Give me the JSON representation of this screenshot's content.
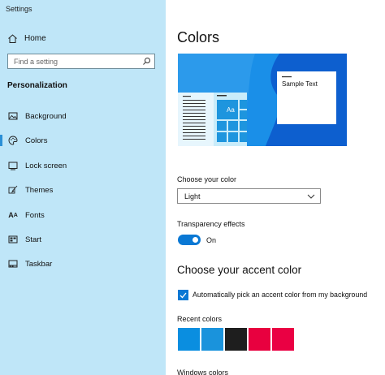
{
  "window": {
    "title": "Settings"
  },
  "sidebar": {
    "home_label": "Home",
    "search_placeholder": "Find a setting",
    "section_heading": "Personalization",
    "items": [
      {
        "label": "Background",
        "icon": "picture-icon"
      },
      {
        "label": "Colors",
        "icon": "palette-icon",
        "selected": true
      },
      {
        "label": "Lock screen",
        "icon": "lock-screen-icon"
      },
      {
        "label": "Themes",
        "icon": "brush-icon"
      },
      {
        "label": "Fonts",
        "icon": "font-icon"
      },
      {
        "label": "Start",
        "icon": "start-icon"
      },
      {
        "label": "Taskbar",
        "icon": "taskbar-icon"
      }
    ]
  },
  "main": {
    "title": "Colors",
    "preview": {
      "sample_text": "Sample Text",
      "tile_label": "Aa"
    },
    "choose_color": {
      "label": "Choose your color",
      "value": "Light"
    },
    "transparency": {
      "label": "Transparency effects",
      "state": "On"
    },
    "accent": {
      "heading": "Choose your accent color",
      "auto_pick_label": "Automatically pick an accent color from my background",
      "auto_pick_checked": true
    },
    "recent_colors": {
      "label": "Recent colors",
      "colors": [
        "#0a8ee0",
        "#1a93dc",
        "#1e1e1e",
        "#e8003f",
        "#ea0043"
      ]
    },
    "windows_colors_label": "Windows colors"
  },
  "colors": {
    "sidebar_bg": "#bfe6f8",
    "accent": "#0a78d4",
    "selection_bar": "#2b8fd6"
  }
}
